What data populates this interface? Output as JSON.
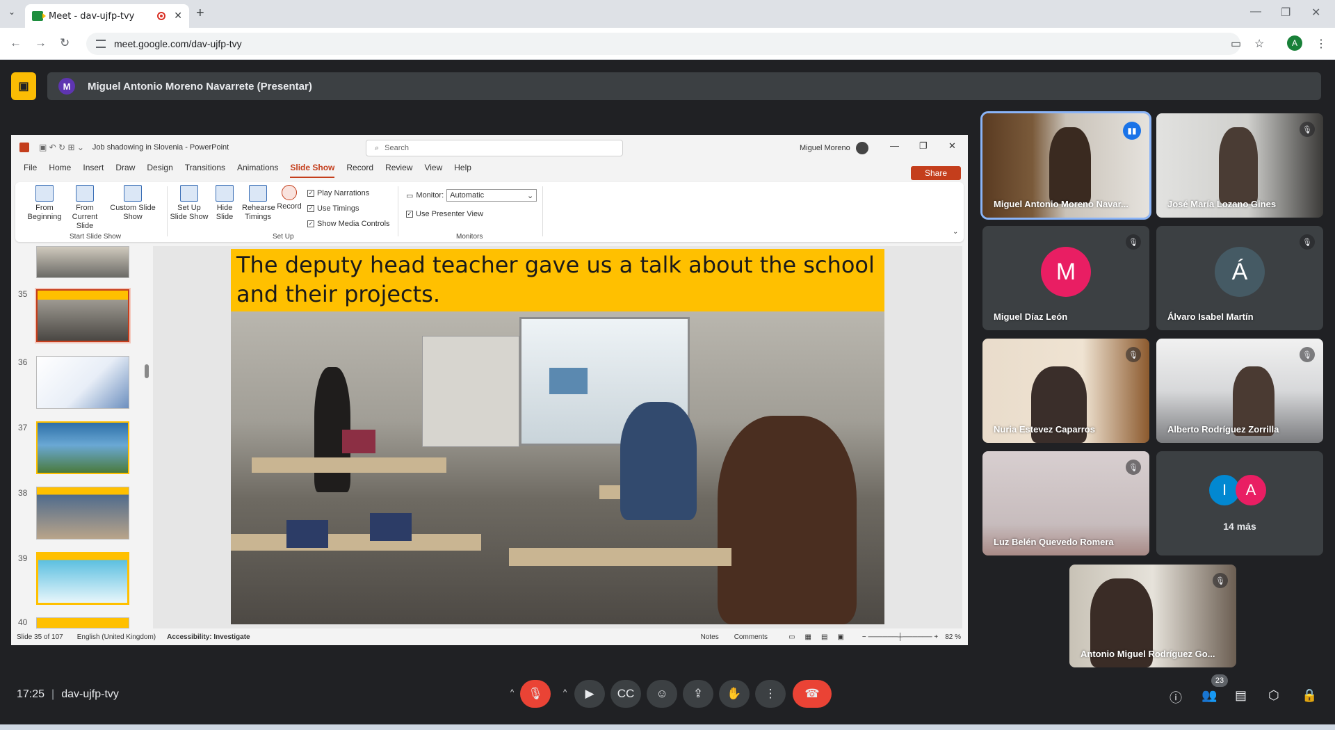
{
  "browser": {
    "tab_title": "Meet - dav-ujfp-tvy",
    "new_tab": "+",
    "url": "meet.google.com/dav-ujfp-tvy",
    "profile_initial": "A"
  },
  "presenter_bar": {
    "avatar_initial": "M",
    "name": "Miguel Antonio Moreno Navarrete (Presentar)"
  },
  "powerpoint": {
    "title": "Job shadowing in Slovenia - PowerPoint",
    "search_placeholder": "Search",
    "user": "Miguel Moreno",
    "menu": [
      "File",
      "Home",
      "Insert",
      "Draw",
      "Design",
      "Transitions",
      "Animations",
      "Slide Show",
      "Record",
      "Review",
      "View",
      "Help"
    ],
    "share_label": "Share",
    "ribbon": {
      "from_beginning": "From Beginning",
      "from_current": "From Current Slide",
      "custom_show": "Custom Slide Show",
      "setup_show": "Set Up Slide Show",
      "hide_slide": "Hide Slide",
      "rehearse": "Rehearse Timings",
      "record": "Record",
      "play_narrations": "Play Narrations",
      "use_timings": "Use Timings",
      "show_media": "Show Media Controls",
      "monitor_label": "Monitor:",
      "monitor_value": "Automatic",
      "presenter_view": "Use Presenter View",
      "group_start": "Start Slide Show",
      "group_setup": "Set Up",
      "group_monitors": "Monitors"
    },
    "slide_numbers": [
      "35",
      "36",
      "37",
      "38",
      "39",
      "40"
    ],
    "slide_title": "The deputy head teacher gave us a talk about the school and their projects.",
    "status": {
      "slide_count": "Slide 35 of 107",
      "language": "English (United Kingdom)",
      "accessibility": "Accessibility: Investigate",
      "notes": "Notes",
      "comments": "Comments",
      "zoom": "82 %"
    }
  },
  "participants": [
    {
      "name": "Miguel Antonio Moreno Navar...",
      "speaking": true
    },
    {
      "name": "José María Lozano Gines",
      "muted": true
    },
    {
      "name": "Miguel Díaz León",
      "initial": "M",
      "color": "#e91e63",
      "muted": true
    },
    {
      "name": "Álvaro Isabel Martín",
      "initial": "Á",
      "color": "#455a64",
      "muted": true
    },
    {
      "name": "Nuria Estevez Caparros",
      "muted": true
    },
    {
      "name": "Alberto Rodríguez Zorrilla",
      "muted": true
    },
    {
      "name": "Luz Belén Quevedo Romera",
      "muted": true
    },
    {
      "name": "14 más",
      "initials": [
        "I",
        "A"
      ],
      "colors": [
        "#0288d1",
        "#e91e63"
      ]
    },
    {
      "name": "Antonio Miguel Rodríguez Go...",
      "muted": true
    }
  ],
  "bottom_bar": {
    "time": "17:25",
    "meeting_code": "dav-ujfp-tvy",
    "people_count": "23"
  }
}
